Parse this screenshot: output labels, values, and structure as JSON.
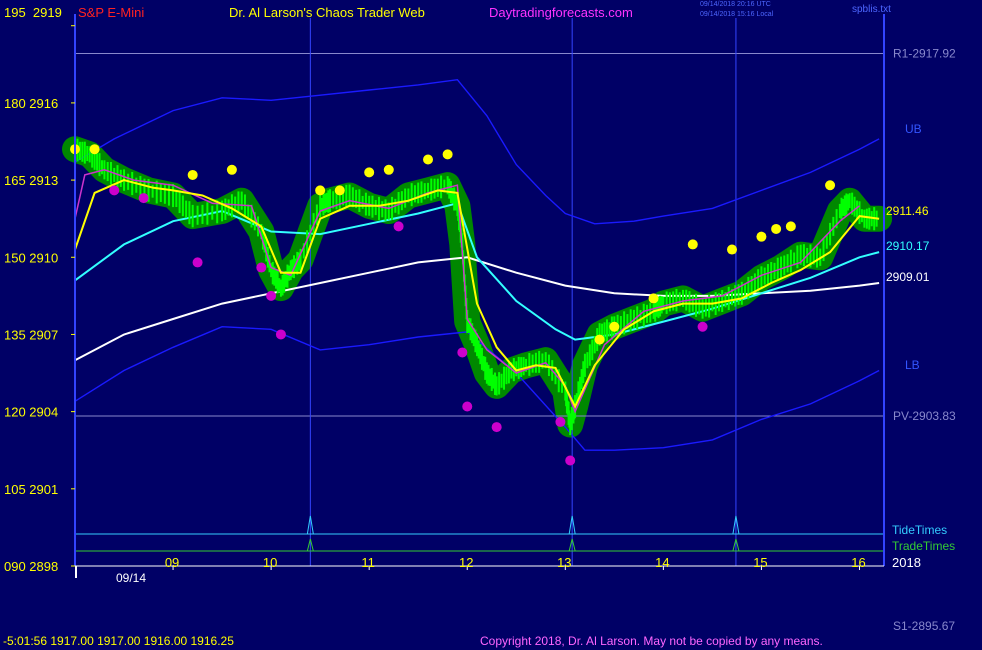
{
  "header": {
    "instrument": "S&P E-Mini",
    "title": "Dr. Al Larson's Chaos Trader Web",
    "site": "Daytradingforecasts.com",
    "timestamp_utc": "09/14/2018 20:16 UTC",
    "timestamp_local": "09/14/2018 15:16 Local",
    "file": "spblis.txt"
  },
  "footer": {
    "readout": "-5:01:56  1917.00 1917.00 1916.00 1916.25",
    "copyright": "Copyright 2018, Dr. Al Larson. May not be copied by any means."
  },
  "colors": {
    "background": "#000066",
    "price": "#00ff00",
    "yellow_line": "#ffff00",
    "cyan_line": "#33ffff",
    "white_line": "#ffffff",
    "magenta_line": "#cc33cc",
    "bands": "#1a1aff",
    "high_dots": "#ffff00",
    "low_dots": "#cc00cc",
    "envelope": "#008800"
  },
  "chart_data": {
    "type": "line",
    "title": "S&P E-Mini",
    "y_axis": {
      "ticks": [
        {
          "label": "195",
          "value": 2919
        },
        {
          "label": "180",
          "value": 2916
        },
        {
          "label": "165",
          "value": 2913
        },
        {
          "label": "150",
          "value": 2910
        },
        {
          "label": "135",
          "value": 2907
        },
        {
          "label": "120",
          "value": 2904
        },
        {
          "label": "105",
          "value": 2901
        },
        {
          "label": "090",
          "value": 2898
        }
      ],
      "ylim": [
        2898,
        2919.3
      ]
    },
    "x_axis": {
      "hours": [
        "09",
        "10",
        "11",
        "12",
        "13",
        "14",
        "15",
        "16"
      ],
      "hour_values": [
        9,
        10,
        11,
        12,
        13,
        14,
        15,
        16
      ],
      "xlim": [
        8.0,
        16.25
      ],
      "date": "09/14",
      "year": "2018"
    },
    "levels": [
      {
        "name": "R1-2917.92",
        "value": 2917.92,
        "color": "#8888cc"
      },
      {
        "name": "PV-2903.83",
        "value": 2903.83,
        "color": "#8888cc"
      },
      {
        "name": "S1-2895.67",
        "value": 2895.67
      }
    ],
    "band_labels": [
      "UB",
      "LB"
    ],
    "timing_rows": [
      {
        "name": "TideTimes",
        "color": "#33ccff",
        "spikes": [
          10.4,
          13.07,
          14.74
        ]
      },
      {
        "name": "TradeTimes",
        "color": "#33cc33",
        "spikes": [
          10.4,
          13.07,
          14.74
        ]
      }
    ],
    "last_values": {
      "yellow": "2911.46",
      "cyan": "2910.17",
      "white": "2909.01"
    },
    "series": [
      {
        "name": "price",
        "x": [
          8.0,
          8.15,
          8.3,
          8.5,
          8.75,
          9.0,
          9.2,
          9.5,
          9.7,
          9.9,
          10.0,
          10.1,
          10.2,
          10.3,
          10.5,
          10.6,
          10.8,
          11.0,
          11.2,
          11.4,
          11.6,
          11.8,
          11.9,
          11.95,
          12.0,
          12.1,
          12.2,
          12.3,
          12.45,
          12.6,
          12.8,
          13.0,
          13.05,
          13.1,
          13.2,
          13.35,
          13.5,
          13.7,
          13.9,
          14.0,
          14.2,
          14.4,
          14.6,
          14.8,
          15.0,
          15.2,
          15.4,
          15.6,
          15.8,
          15.9,
          16.05,
          16.2
        ],
        "y": [
          2914.2,
          2914.0,
          2913.4,
          2913.0,
          2912.6,
          2912.4,
          2911.6,
          2911.8,
          2912.2,
          2911.0,
          2909.5,
          2908.8,
          2909.5,
          2909.9,
          2912.0,
          2912.2,
          2912.4,
          2912.0,
          2911.8,
          2912.4,
          2912.6,
          2912.8,
          2912.0,
          2910.5,
          2907.5,
          2906.6,
          2905.5,
          2905.0,
          2905.6,
          2905.8,
          2906.0,
          2904.8,
          2903.5,
          2904.2,
          2905.8,
          2907.0,
          2907.3,
          2907.6,
          2907.9,
          2908.2,
          2908.4,
          2908.0,
          2908.3,
          2908.6,
          2909.2,
          2909.6,
          2910.1,
          2910.0,
          2911.8,
          2912.2,
          2911.5,
          2911.5
        ]
      },
      {
        "name": "yellow",
        "x": [
          8.0,
          8.2,
          8.5,
          8.8,
          9.0,
          9.3,
          9.6,
          9.9,
          10.1,
          10.3,
          10.5,
          10.8,
          11.1,
          11.4,
          11.7,
          11.9,
          12.1,
          12.3,
          12.5,
          12.7,
          12.9,
          13.1,
          13.3,
          13.6,
          13.9,
          14.2,
          14.5,
          14.8,
          15.1,
          15.4,
          15.7,
          16.0,
          16.2
        ],
        "y": [
          2910.3,
          2912.5,
          2913.0,
          2912.7,
          2912.6,
          2912.4,
          2911.9,
          2911.2,
          2909.4,
          2909.4,
          2911.5,
          2912.0,
          2912.0,
          2912.2,
          2912.6,
          2912.5,
          2908.2,
          2906.5,
          2905.6,
          2905.8,
          2905.7,
          2904.2,
          2905.8,
          2907.2,
          2907.9,
          2908.2,
          2908.2,
          2908.4,
          2909.0,
          2909.5,
          2910.2,
          2911.6,
          2911.5
        ]
      },
      {
        "name": "magenta",
        "x": [
          8.0,
          8.1,
          8.3,
          8.6,
          9.0,
          9.4,
          9.8,
          10.0,
          10.2,
          10.5,
          10.8,
          11.2,
          11.6,
          11.9,
          12.0,
          12.2,
          12.5,
          12.8,
          13.0,
          13.1,
          13.4,
          13.8,
          14.2,
          14.6,
          15.0,
          15.4,
          15.8,
          16.0
        ],
        "y": [
          2911.5,
          2913.2,
          2913.4,
          2913.0,
          2912.8,
          2912.1,
          2912.0,
          2909.6,
          2909.3,
          2911.8,
          2912.2,
          2911.9,
          2912.5,
          2912.8,
          2907.6,
          2906.4,
          2905.5,
          2905.9,
          2905.0,
          2904.0,
          2906.6,
          2907.9,
          2908.3,
          2908.5,
          2909.3,
          2909.8,
          2911.4,
          2912.0
        ]
      },
      {
        "name": "cyan",
        "x": [
          8.0,
          8.5,
          9.0,
          9.5,
          10.0,
          10.5,
          11.0,
          11.5,
          11.9,
          12.1,
          12.5,
          12.9,
          13.1,
          13.5,
          14.0,
          14.5,
          15.0,
          15.5,
          16.0,
          16.2
        ],
        "y": [
          2909.1,
          2910.5,
          2911.4,
          2911.8,
          2911.0,
          2910.9,
          2911.3,
          2911.7,
          2912.1,
          2910.0,
          2908.3,
          2907.2,
          2906.8,
          2907.0,
          2907.5,
          2908.0,
          2908.6,
          2909.2,
          2910.0,
          2910.2
        ]
      },
      {
        "name": "white",
        "x": [
          8.0,
          8.5,
          9.0,
          9.5,
          10.0,
          10.5,
          11.0,
          11.5,
          12.0,
          12.5,
          13.0,
          13.5,
          14.0,
          14.5,
          15.0,
          15.5,
          16.0,
          16.2
        ],
        "y": [
          2906.0,
          2907.0,
          2907.6,
          2908.2,
          2908.6,
          2909.0,
          2909.4,
          2909.8,
          2910.0,
          2909.4,
          2908.9,
          2908.6,
          2908.5,
          2908.5,
          2908.6,
          2908.7,
          2908.9,
          2909.0
        ]
      },
      {
        "name": "upper band",
        "x": [
          8.0,
          8.4,
          9.0,
          9.5,
          10.0,
          10.5,
          11.0,
          11.5,
          11.9,
          12.2,
          12.5,
          12.8,
          13.0,
          13.3,
          13.7,
          14.0,
          14.5,
          15.0,
          15.5,
          16.0,
          16.2
        ],
        "y": [
          2913.7,
          2914.6,
          2915.7,
          2916.2,
          2916.1,
          2916.3,
          2916.5,
          2916.7,
          2916.9,
          2915.5,
          2913.6,
          2912.4,
          2911.7,
          2911.3,
          2911.4,
          2911.6,
          2911.9,
          2912.6,
          2913.3,
          2914.2,
          2914.6
        ]
      },
      {
        "name": "lower band",
        "x": [
          8.0,
          8.5,
          9.0,
          9.5,
          10.0,
          10.5,
          11.0,
          11.5,
          12.0,
          12.5,
          13.0,
          13.2,
          13.5,
          14.0,
          14.5,
          15.0,
          15.5,
          16.0,
          16.2
        ],
        "y": [
          2904.4,
          2905.6,
          2906.5,
          2907.3,
          2907.2,
          2906.4,
          2906.6,
          2906.9,
          2907.1,
          2905.5,
          2903.4,
          2902.5,
          2902.5,
          2902.6,
          2902.9,
          2903.7,
          2904.3,
          2905.2,
          2905.6
        ]
      }
    ],
    "high_dots": [
      {
        "x": 8.0,
        "y": 2914.2
      },
      {
        "x": 8.2,
        "y": 2914.2
      },
      {
        "x": 9.2,
        "y": 2913.2
      },
      {
        "x": 9.6,
        "y": 2913.4
      },
      {
        "x": 10.5,
        "y": 2912.6
      },
      {
        "x": 10.7,
        "y": 2912.6
      },
      {
        "x": 11.0,
        "y": 2913.3
      },
      {
        "x": 11.2,
        "y": 2913.4
      },
      {
        "x": 11.6,
        "y": 2913.8
      },
      {
        "x": 11.8,
        "y": 2914.0
      },
      {
        "x": 13.35,
        "y": 2906.8
      },
      {
        "x": 13.5,
        "y": 2907.3
      },
      {
        "x": 13.9,
        "y": 2908.4
      },
      {
        "x": 14.3,
        "y": 2910.5
      },
      {
        "x": 14.7,
        "y": 2910.3
      },
      {
        "x": 15.0,
        "y": 2910.8
      },
      {
        "x": 15.15,
        "y": 2911.1
      },
      {
        "x": 15.3,
        "y": 2911.2
      },
      {
        "x": 15.7,
        "y": 2912.8
      }
    ],
    "low_dots": [
      {
        "x": 8.4,
        "y": 2912.6
      },
      {
        "x": 8.7,
        "y": 2912.3
      },
      {
        "x": 9.25,
        "y": 2909.8
      },
      {
        "x": 9.9,
        "y": 2909.6
      },
      {
        "x": 10.0,
        "y": 2908.5
      },
      {
        "x": 10.1,
        "y": 2907.0
      },
      {
        "x": 11.3,
        "y": 2911.2
      },
      {
        "x": 11.95,
        "y": 2906.3
      },
      {
        "x": 12.0,
        "y": 2904.2
      },
      {
        "x": 12.3,
        "y": 2903.4
      },
      {
        "x": 12.95,
        "y": 2903.6
      },
      {
        "x": 13.05,
        "y": 2902.1
      },
      {
        "x": 14.4,
        "y": 2907.3
      }
    ]
  }
}
